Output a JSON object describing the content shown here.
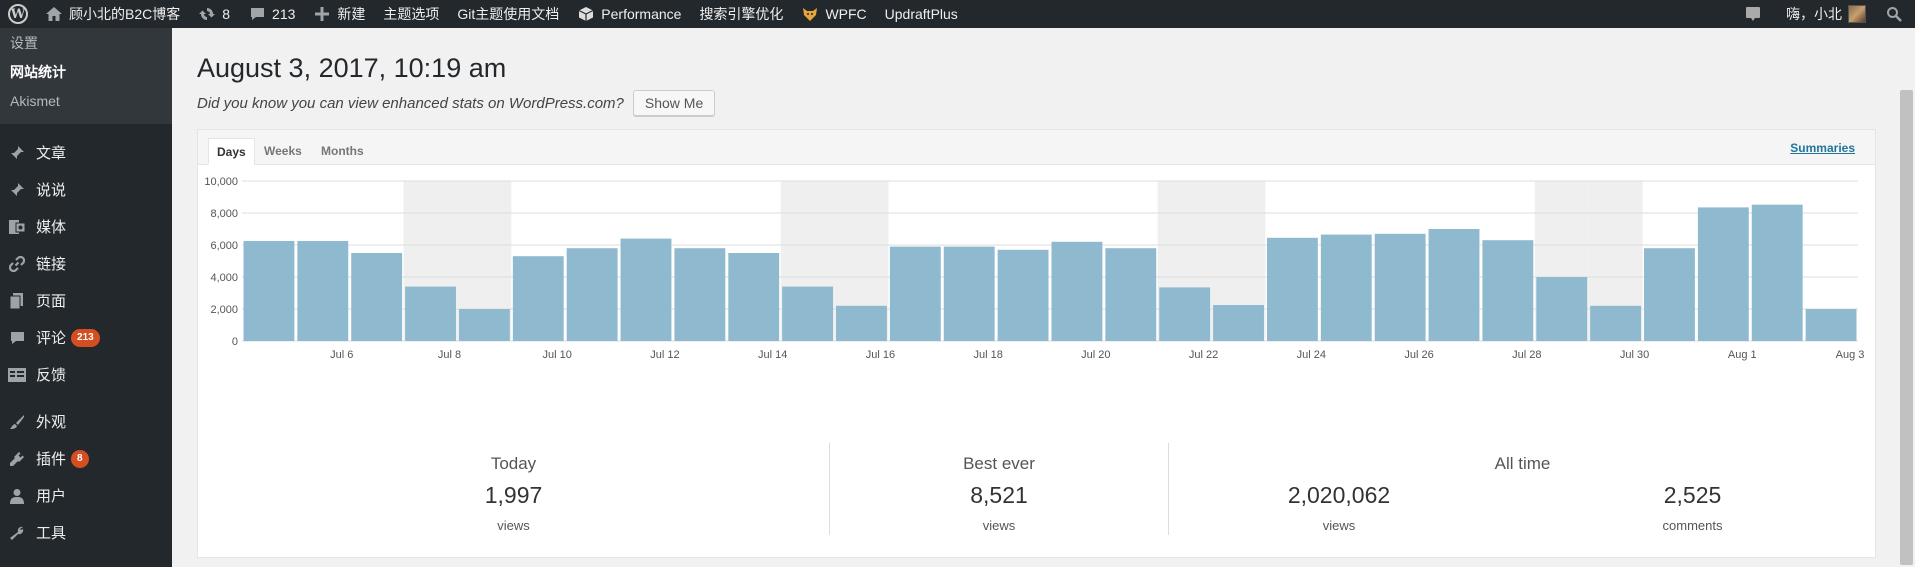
{
  "adminbar": {
    "site_name": "顾小北的B2C博客",
    "updates_count": "8",
    "comments_count": "213",
    "new_label": "新建",
    "theme_options": "主题选项",
    "git_docs": "Git主题使用文档",
    "performance": "Performance",
    "seo": "搜索引擎优化",
    "wpfc": "WPFC",
    "updraft": "UpdraftPlus",
    "greeting": "嗨，小北"
  },
  "sidebar": {
    "submenu": [
      "设置",
      "网站统计",
      "Akismet"
    ],
    "items": [
      {
        "label": "文章",
        "icon": "pin-icon"
      },
      {
        "label": "说说",
        "icon": "pin-icon"
      },
      {
        "label": "媒体",
        "icon": "media-icon"
      },
      {
        "label": "链接",
        "icon": "link-icon"
      },
      {
        "label": "页面",
        "icon": "page-icon"
      },
      {
        "label": "评论",
        "icon": "comment-icon",
        "badge": "213"
      },
      {
        "label": "反馈",
        "icon": "feedback-icon"
      },
      {
        "label": "外观",
        "icon": "brush-icon"
      },
      {
        "label": "插件",
        "icon": "plugin-icon",
        "badge": "8"
      },
      {
        "label": "用户",
        "icon": "user-icon"
      },
      {
        "label": "工具",
        "icon": "wrench-icon"
      }
    ]
  },
  "main": {
    "title": "August 3, 2017, 10:19 am",
    "promo_text": "Did you know you can view enhanced stats on WordPress.com?",
    "show_me": "Show Me",
    "tabs": [
      "Days",
      "Weeks",
      "Months"
    ],
    "active_tab": "Days",
    "summaries_link": "Summaries"
  },
  "chart_data": {
    "type": "bar",
    "categories": [
      "Jul 5",
      "Jul 6",
      "Jul 7",
      "Jul 8",
      "Jul 9",
      "Jul 10",
      "Jul 11",
      "Jul 12",
      "Jul 13",
      "Jul 14",
      "Jul 15",
      "Jul 16",
      "Jul 17",
      "Jul 18",
      "Jul 19",
      "Jul 20",
      "Jul 21",
      "Jul 22",
      "Jul 23",
      "Jul 24",
      "Jul 25",
      "Jul 26",
      "Jul 27",
      "Jul 28",
      "Jul 29",
      "Jul 30",
      "Jul 31",
      "Aug 1",
      "Aug 2",
      "Aug 3"
    ],
    "tick_labels": [
      "Jul 6",
      "Jul 8",
      "Jul 10",
      "Jul 12",
      "Jul 14",
      "Jul 16",
      "Jul 18",
      "Jul 20",
      "Jul 22",
      "Jul 24",
      "Jul 26",
      "Jul 28",
      "Jul 30",
      "Aug 1",
      "Aug 3"
    ],
    "values": [
      6250,
      6250,
      5500,
      3400,
      2000,
      5300,
      5800,
      6400,
      5800,
      5500,
      3400,
      2200,
      5900,
      5900,
      5700,
      6200,
      5800,
      3350,
      2250,
      6450,
      6650,
      6700,
      7000,
      6300,
      4000,
      2200,
      5800,
      8350,
      8521,
      1997
    ],
    "weekend_indices": [
      3,
      4,
      10,
      11,
      17,
      18,
      24,
      25
    ],
    "ylim": [
      0,
      10000
    ],
    "yticks": [
      "0",
      "2,000",
      "4,000",
      "6,000",
      "8,000",
      "10,000"
    ],
    "bar_color": "#8fb9cf",
    "weekend_color": "#efefef",
    "grid": true
  },
  "summary": {
    "today": {
      "label": "Today",
      "value": "1,997",
      "unit": "views"
    },
    "best": {
      "label": "Best ever",
      "value": "8,521",
      "unit": "views"
    },
    "all_time": {
      "label": "All time",
      "views": "2,020,062",
      "views_unit": "views",
      "comments": "2,525",
      "comments_unit": "comments"
    }
  }
}
